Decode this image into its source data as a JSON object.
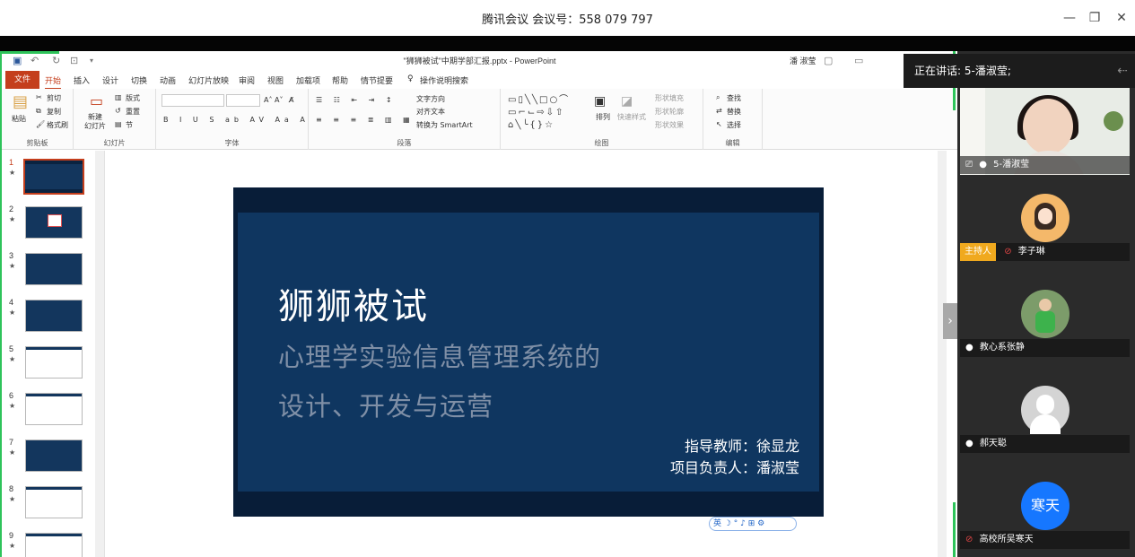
{
  "window": {
    "title": "腾讯会议 会议号：558 079 797",
    "minimize": "—",
    "maximize": "❐",
    "close": "✕"
  },
  "ppt": {
    "doc_title": "\"狮狮被试\"中期学部汇报.pptx - PowerPoint",
    "user": "潘 淑莹",
    "tabs": [
      "文件",
      "开始",
      "插入",
      "设计",
      "切换",
      "动画",
      "幻灯片放映",
      "审阅",
      "视图",
      "加载项",
      "帮助",
      "情节提要"
    ],
    "tell_me": "操作说明搜索",
    "ribbon": {
      "paste": "粘贴",
      "cut": "剪切",
      "copy": "复制",
      "format_painter": "格式刷",
      "clipboard": "剪贴板",
      "new_slide_1": "新建",
      "new_slide_2": "幻灯片",
      "layout": "版式",
      "reset": "重置",
      "section": "节",
      "slides": "幻灯片",
      "font": "字体",
      "text_direction": "文字方向",
      "align_text": "对齐文本",
      "smartart": "转换为 SmartArt",
      "paragraph": "段落",
      "arrange": "排列",
      "quick_styles": "快速样式",
      "shape_fill": "形状填充",
      "shape_outline": "形状轮廓",
      "shape_effects": "形状效果",
      "drawing": "绘图",
      "find": "查找",
      "replace": "替换",
      "select": "选择",
      "editing": "编辑"
    },
    "thumbnails": [
      {
        "num": "1",
        "star": "★"
      },
      {
        "num": "2",
        "star": "★"
      },
      {
        "num": "3",
        "star": "★"
      },
      {
        "num": "4",
        "star": "★"
      },
      {
        "num": "5",
        "star": "★"
      },
      {
        "num": "6",
        "star": "★"
      },
      {
        "num": "7",
        "star": "★"
      },
      {
        "num": "8",
        "star": "★"
      },
      {
        "num": "9",
        "star": "★"
      }
    ],
    "slide": {
      "title": "狮狮被试",
      "subtitle1": "心理学实验信息管理系统的",
      "subtitle2": "设计、开发与运营",
      "advisor": "指导教师：徐显龙",
      "lead": "项目负责人：潘淑莹"
    },
    "ime": "英 ☽ ° ♪ ⊞ ⚙"
  },
  "meeting": {
    "speaking": "正在讲话: 5-潘淑莹;",
    "video_name": "5-潘淑莹",
    "participants": [
      {
        "name": "李子琳",
        "host_badge": "主持人",
        "avatar_color": "#f4b86a"
      },
      {
        "name": "教心系张静",
        "avatar_color": "#7c9c6a"
      },
      {
        "name": "郝天聪",
        "avatar_color": "#d4d4d4"
      },
      {
        "name": "高校所吴寒天",
        "avatar_text": "寒天",
        "avatar_color": "#1677ff"
      }
    ]
  }
}
